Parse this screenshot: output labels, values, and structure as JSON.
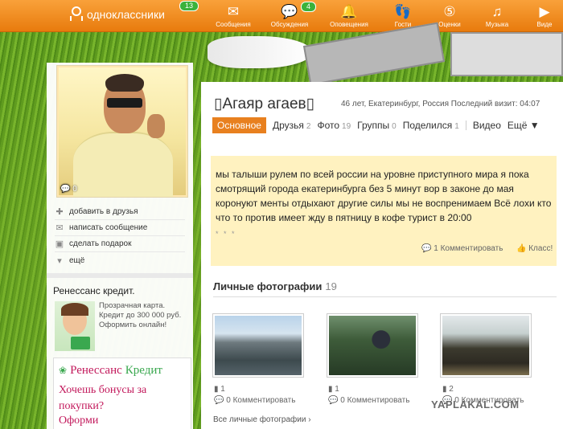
{
  "topbar": {
    "logo_text": "одноклассники",
    "logo_badge": "13",
    "nav": [
      {
        "label": "Сообщения",
        "icon": "envelope-icon",
        "badge": ""
      },
      {
        "label": "Обсуждения",
        "icon": "speech-bubbles-icon",
        "badge": "4"
      },
      {
        "label": "Оповещения",
        "icon": "bell-icon",
        "badge": ""
      },
      {
        "label": "Гости",
        "icon": "footprints-icon",
        "badge": ""
      },
      {
        "label": "Оценки",
        "icon": "five-rating-icon",
        "badge": ""
      },
      {
        "label": "Музыка",
        "icon": "music-note-icon",
        "badge": ""
      },
      {
        "label": "Виде",
        "icon": "video-icon",
        "badge": ""
      }
    ]
  },
  "profile": {
    "name": "▯Агаяр агаев▯",
    "meta": "46 лет, Екатеринбург, Россия  Последний визит: 04:07",
    "avatar_comments": "0"
  },
  "actions": [
    {
      "label": "добавить в друзья",
      "icon": "plus-icon"
    },
    {
      "label": "написать сообщение",
      "icon": "envelope-icon"
    },
    {
      "label": "сделать подарок",
      "icon": "gift-icon"
    },
    {
      "label": "ещё",
      "icon": "chevron-down-icon"
    }
  ],
  "tabs": [
    {
      "label": "Основное",
      "count": ""
    },
    {
      "label": "Друзья",
      "count": "2"
    },
    {
      "label": "Фото",
      "count": "19"
    },
    {
      "label": "Группы",
      "count": "0"
    },
    {
      "label": "Поделился",
      "count": "1"
    },
    {
      "label": "Видео",
      "count": ""
    },
    {
      "label": "Ещё ▼",
      "count": ""
    }
  ],
  "status": {
    "text": "мы талыши рулем по всей россии на уровне приступного мира я пока смотрящий города екатеринбурга без 5 минут вор в законе до мая коронуют менты отдыхают другие силы мы не воспренимаем Всё лохи кто что то против имеет жду в пятницу в кофе турист в 20:00",
    "dots": "* * *",
    "comment": "1 Комментировать",
    "class": "Класс!"
  },
  "photos_section": {
    "title": "Личные фотографии",
    "count": "19",
    "items": [
      {
        "likes": "1",
        "comments": "0 Комментировать"
      },
      {
        "likes": "1",
        "comments": "0 Комментировать"
      },
      {
        "likes": "2",
        "comments": "0 Комментировать"
      }
    ],
    "all_link": "Все личные фотографии ›"
  },
  "ad1": {
    "title": "Ренессанс кредит.",
    "text": "Прозрачная карта. Кредит до 300 000 руб. Оформить онлайн!"
  },
  "ad2": {
    "logo_a": "Ренессанс",
    "logo_b": "Кредит",
    "headline": "Хочешь бонусы за покупки?",
    "cta": "Оформи"
  },
  "watermark": "YAPLAKAL.COM"
}
